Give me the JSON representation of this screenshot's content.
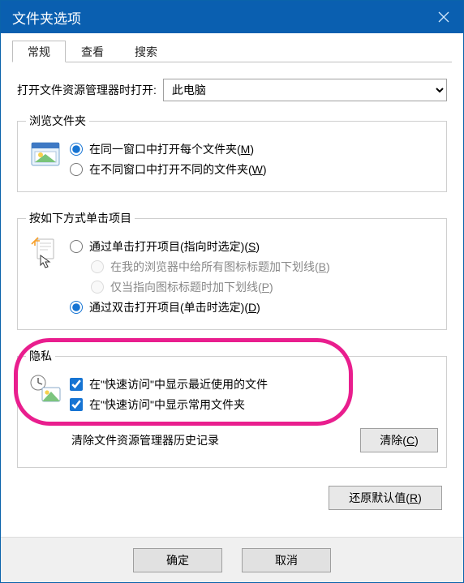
{
  "window": {
    "title": "文件夹选项"
  },
  "tabs": {
    "general": "常规",
    "view": "查看",
    "search": "搜索"
  },
  "open_explorer": {
    "label": "打开文件资源管理器时打开:",
    "value": "此电脑"
  },
  "browse": {
    "legend": "浏览文件夹",
    "same_label": "在同一窗口中打开每个文件夹(",
    "same_key": "M",
    "same_after": ")",
    "diff_label": "在不同窗口中打开不同的文件夹(",
    "diff_key": "W",
    "diff_after": ")"
  },
  "click": {
    "legend": "按如下方式单击项目",
    "single_label": "通过单击打开项目(指向时选定)(",
    "single_key": "S",
    "single_after": ")",
    "sub1_label": "在我的浏览器中给所有图标标题加下划线(",
    "sub1_key": "B",
    "sub1_after": ")",
    "sub2_label": "仅当指向图标标题时加下划线(",
    "sub2_key": "P",
    "sub2_after": ")",
    "double_label": "通过双击打开项目(单击时选定)(",
    "double_key": "D",
    "double_after": ")"
  },
  "privacy": {
    "legend": "隐私",
    "recent": "在\"快速访问\"中显示最近使用的文件",
    "frequent": "在\"快速访问\"中显示常用文件夹",
    "clear_label": "清除文件资源管理器历史记录",
    "clear_btn_pre": "清除(",
    "clear_btn_key": "C",
    "clear_btn_post": ")"
  },
  "restore": {
    "pre": "还原默认值(",
    "key": "R",
    "post": ")"
  },
  "footer": {
    "ok": "确定",
    "cancel": "取消"
  }
}
